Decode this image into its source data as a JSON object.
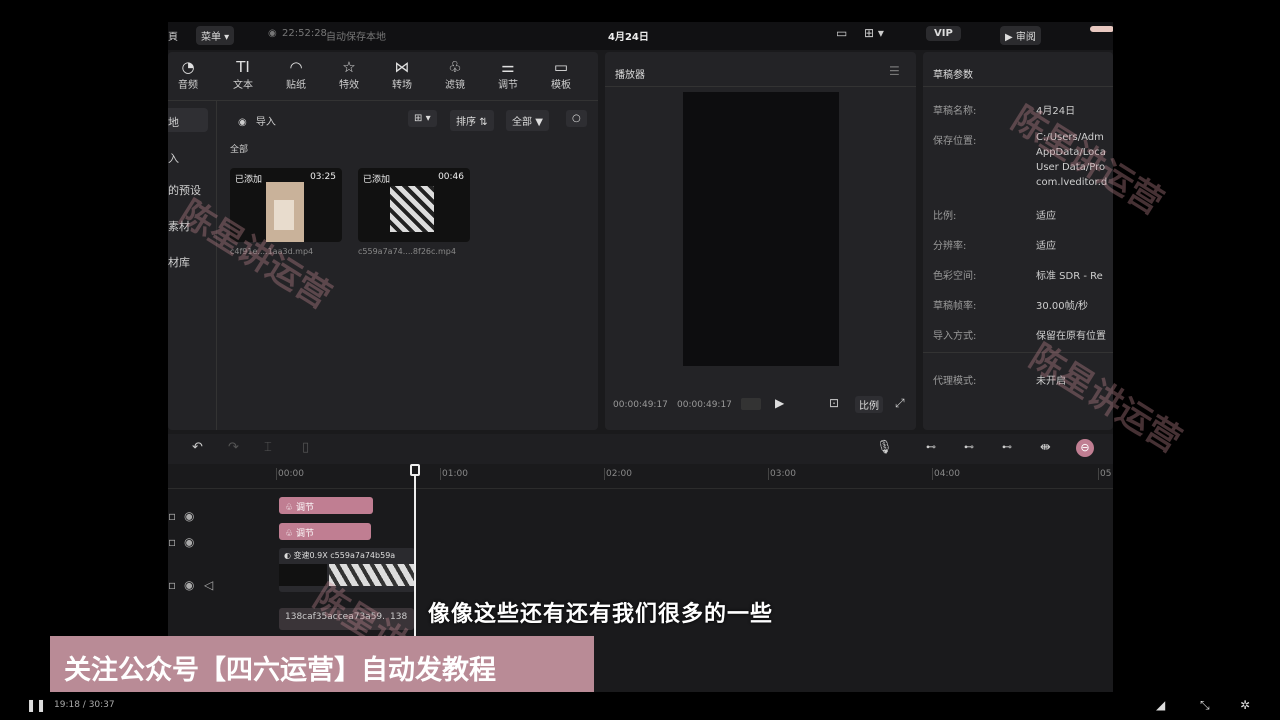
{
  "topbar": {
    "menu": "菜单",
    "autosave_time": "22:52:28",
    "autosave_text": "自动保存本地",
    "project_title": "4月24日",
    "vip": "VIP",
    "review": "审阅",
    "export": ""
  },
  "toolbar": [
    {
      "icon": "audio-icon",
      "glyph": "◔",
      "label": "音频"
    },
    {
      "icon": "text-icon",
      "glyph": "TI",
      "label": "文本"
    },
    {
      "icon": "sticker-icon",
      "glyph": "◠",
      "label": "贴纸"
    },
    {
      "icon": "effects-icon",
      "glyph": "☆",
      "label": "特效"
    },
    {
      "icon": "transition-icon",
      "glyph": "⋈",
      "label": "转场"
    },
    {
      "icon": "filter-icon",
      "glyph": "♧",
      "label": "滤镜"
    },
    {
      "icon": "adjust-icon",
      "glyph": "⚌",
      "label": "调节"
    },
    {
      "icon": "template-icon",
      "glyph": "▭",
      "label": "模板"
    }
  ],
  "sidebar": [
    "地",
    "入",
    "的预设",
    "素材",
    "材库"
  ],
  "media": {
    "import_label": "导入",
    "sort_label": "排序",
    "filter_label": "全部",
    "section": "全部",
    "items": [
      {
        "badge": "已添加",
        "duration": "03:25",
        "name": "c4f91e....1aa3d.mp4"
      },
      {
        "badge": "已添加",
        "duration": "00:46",
        "name": "c559a7a74....8f26c.mp4"
      }
    ]
  },
  "player": {
    "title": "播放器",
    "current_time": "00:00:49:17",
    "total_time": "00:00:49:17",
    "ratio_btn": "比例"
  },
  "props": {
    "title": "草稿参数",
    "rows": [
      {
        "label": "草稿名称:",
        "value": "4月24日"
      },
      {
        "label": "保存位置:",
        "value": "C:/Users/Adm"
      },
      {
        "label": "",
        "value": "AppData/Loca"
      },
      {
        "label": "",
        "value": "User Data/Pro"
      },
      {
        "label": "",
        "value": "com.lveditor.d"
      },
      {
        "label": "比例:",
        "value": "适应"
      },
      {
        "label": "分辨率:",
        "value": "适应"
      },
      {
        "label": "色彩空间:",
        "value": "标准 SDR - Re"
      },
      {
        "label": "草稿帧率:",
        "value": "30.00帧/秒"
      },
      {
        "label": "导入方式:",
        "value": "保留在原有位置"
      },
      {
        "label": "代理模式:",
        "value": "未开启"
      }
    ]
  },
  "timeline": {
    "ticks": [
      "00:00",
      "01:00",
      "02:00",
      "03:00",
      "04:00",
      "05"
    ],
    "clip1": "调节",
    "clip2": "调节",
    "clip3_speed": "变速0.9X",
    "clip3_name": "c559a7a74b59a",
    "clip4": "138caf35accea73a59...",
    "clip4b": "138"
  },
  "overlay": {
    "watermark": "陈星讲运营",
    "subtitle": "像像这些还有还有我们很多的一些",
    "banner": "关注公众号【四六运营】自动发教程",
    "video_time": "19:18 / 30:37"
  }
}
